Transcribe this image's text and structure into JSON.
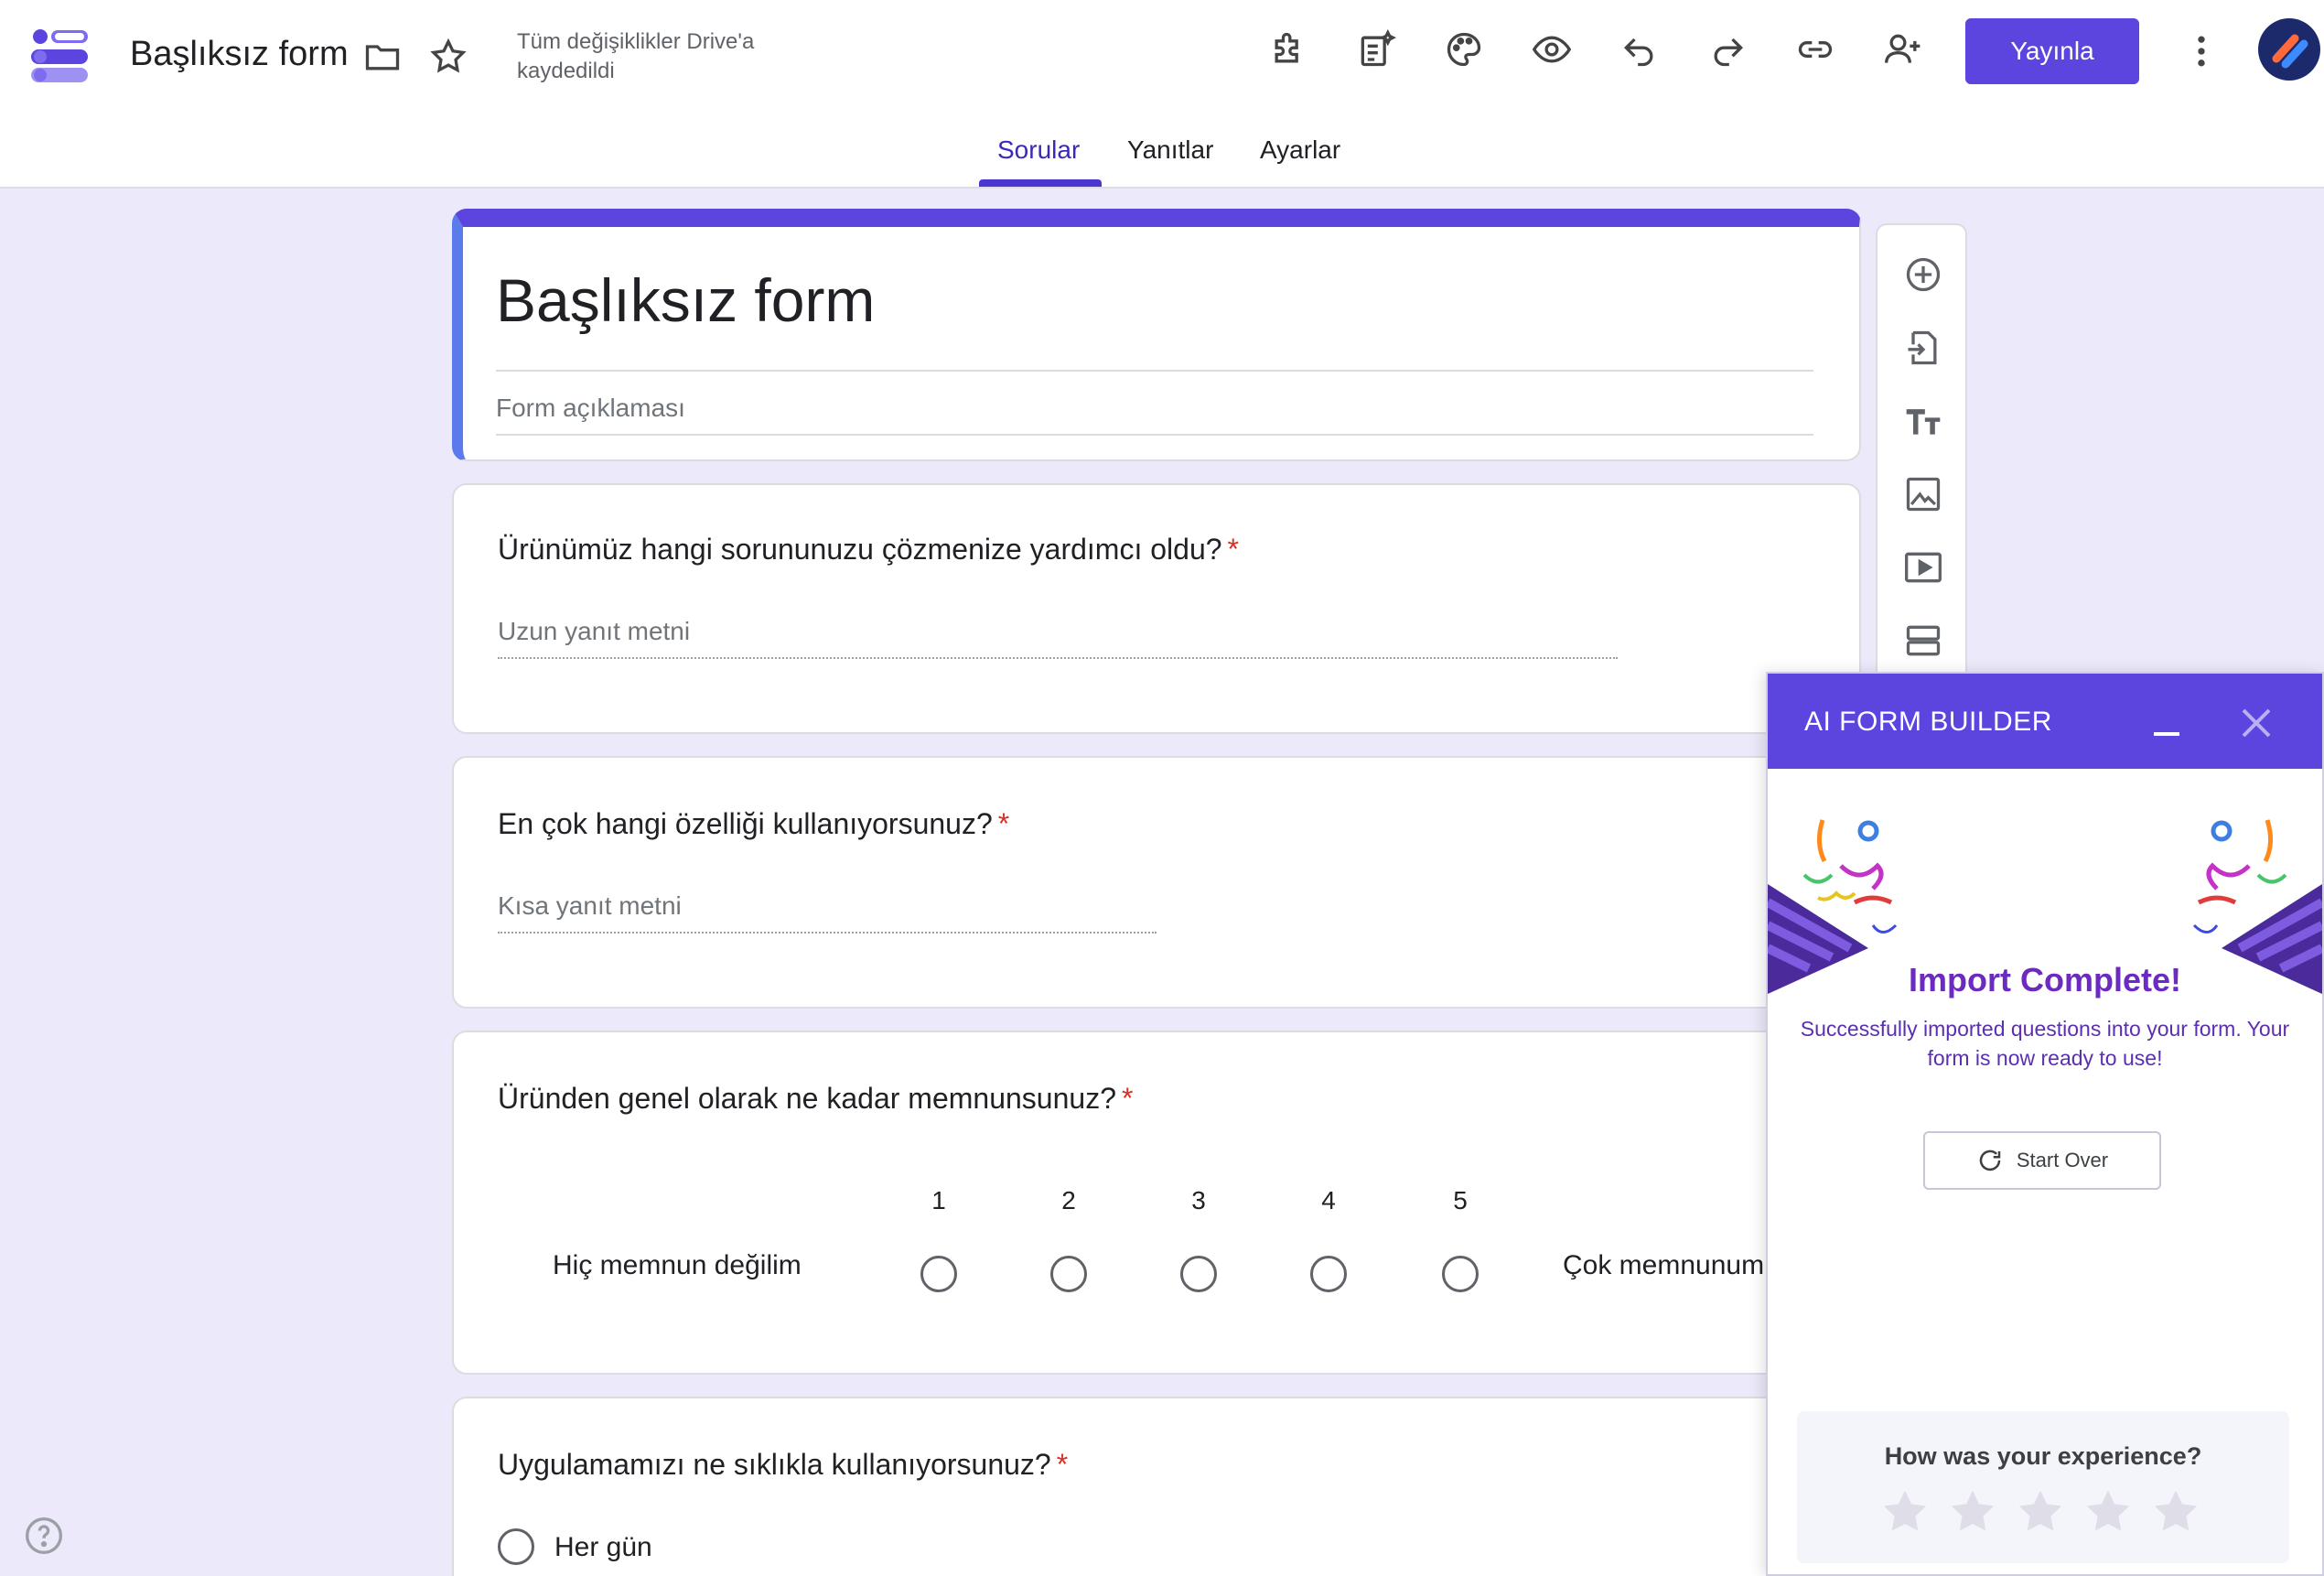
{
  "header": {
    "app_title": "Başlıksız form",
    "save_status": "Tüm değişiklikler Drive'a kaydedildi",
    "publish_label": "Yayınla",
    "icons": [
      "folder-icon",
      "star-icon",
      "addon-icon",
      "ai-doc-icon",
      "palette-icon",
      "preview-icon",
      "undo-icon",
      "redo-icon",
      "link-icon",
      "add-collaborator-icon",
      "more-icon"
    ]
  },
  "tabs": [
    {
      "label": "Sorular",
      "active": true
    },
    {
      "label": "Yanıtlar",
      "active": false
    },
    {
      "label": "Ayarlar",
      "active": false
    }
  ],
  "form": {
    "title": "Başlıksız form",
    "description_placeholder": "Form açıklaması",
    "questions": [
      {
        "title": "Ürünümüz hangi sorununuzu çözmenize yardımcı oldu?",
        "required": "*",
        "type": "paragraph",
        "placeholder": "Uzun yanıt metni"
      },
      {
        "title": "En çok hangi özelliği kullanıyorsunuz?",
        "required": "*",
        "type": "short",
        "placeholder": "Kısa yanıt metni"
      },
      {
        "title": "Üründen genel olarak ne kadar memnunsunuz?",
        "required": "*",
        "type": "scale",
        "scale": [
          "1",
          "2",
          "3",
          "4",
          "5"
        ],
        "low_label": "Hiç memnun değilim",
        "high_label": "Çok memnunum"
      },
      {
        "title": "Uygulamamızı ne sıklıkla kullanıyorsunuz?",
        "required": "*",
        "type": "multiple_choice",
        "options": [
          "Her gün"
        ]
      }
    ]
  },
  "toolbar": [
    "add-question-icon",
    "import-questions-icon",
    "add-title-icon",
    "add-image-icon",
    "add-video-icon",
    "add-section-icon"
  ],
  "ai_panel": {
    "title": "AI FORM BUILDER",
    "status_title": "Import Complete!",
    "message": "Successfully imported questions into your form. Your form is now ready to use!",
    "start_over_label": "Start Over",
    "feedback_question": "How was your experience?",
    "rating_max": 5,
    "colors": {
      "accent": "#5b45de",
      "title": "#6c2bc0"
    }
  }
}
